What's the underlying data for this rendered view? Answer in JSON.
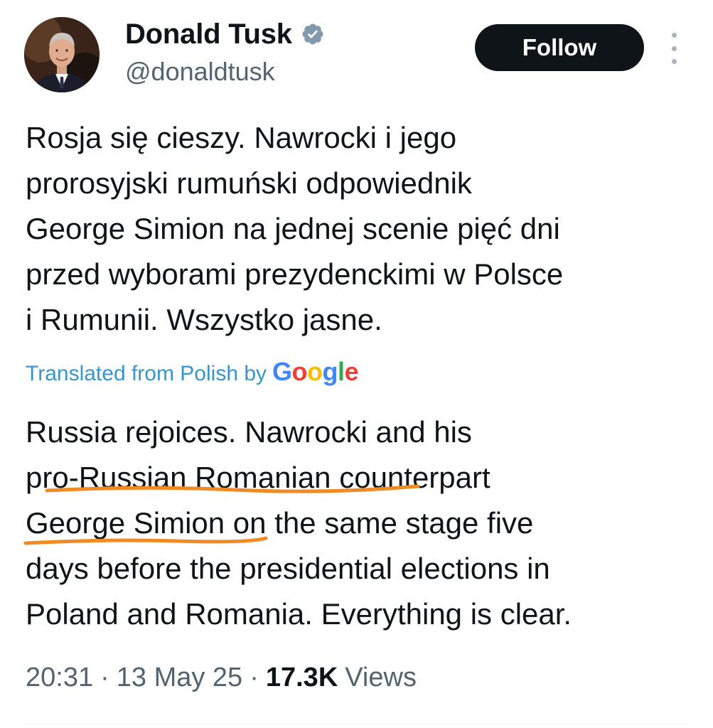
{
  "author": {
    "display_name": "Donald Tusk",
    "handle": "@donaldtusk",
    "verified_icon": "verified-badge-icon"
  },
  "actions": {
    "follow_label": "Follow",
    "more_icon": "more-vertical-icon"
  },
  "tweet": {
    "original_lines": [
      "Rosja się cieszy. Nawrocki i jego",
      "prorosyjski rumuński odpowiednik",
      "George Simion na jednej scenie pięć dni",
      "przed wyborami prezydenckimi w Polsce",
      "i Rumunii. Wszystko jasne."
    ],
    "translation_note": {
      "label": "Translated from Polish by",
      "provider": "Google"
    },
    "translated_lines": [
      "Russia rejoices. Nawrocki and his",
      "pro-Russian Romanian counterpart",
      "George Simion on the same stage five",
      "days before the presidential elections in",
      "Poland and Romania. Everything is clear."
    ]
  },
  "meta": {
    "time": "20:31",
    "separator": "·",
    "date": "13 May 25",
    "views_count": "17.3K",
    "views_label": "Views"
  },
  "colors": {
    "text": "#0f1419",
    "secondary": "#536471",
    "link": "#1d9bf0",
    "annotation_underline": "#f08a24",
    "follow_bg": "#0f1419",
    "verified": "#829aab"
  }
}
